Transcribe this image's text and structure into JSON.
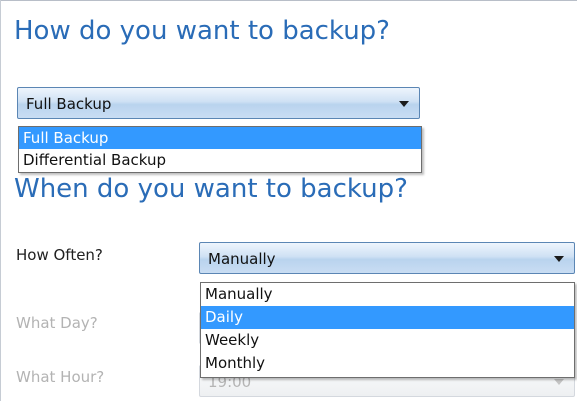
{
  "backup_section": {
    "heading": "How do you want to backup?",
    "type_select": {
      "value": "Full Backup",
      "options": [
        "Full Backup",
        "Differential Backup"
      ],
      "highlighted": "Full Backup"
    }
  },
  "schedule_section": {
    "heading": "When do you want to backup?",
    "how_often": {
      "label": "How Often?",
      "value": "Manually",
      "options": [
        "Manually",
        "Daily",
        "Weekly",
        "Monthly"
      ],
      "highlighted": "Daily"
    },
    "what_day": {
      "label": "What Day?",
      "enabled": false
    },
    "what_hour": {
      "label": "What Hour?",
      "value": "19:00",
      "enabled": false
    }
  },
  "colors": {
    "heading": "#2a6cb7",
    "highlight": "#3399ff",
    "disabled_text": "#b3b3b3"
  },
  "icons": {
    "dropdown_arrow": "chevron-down-icon"
  }
}
